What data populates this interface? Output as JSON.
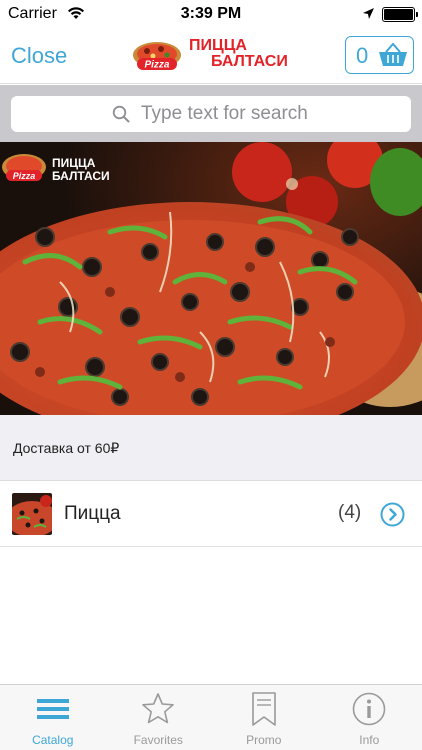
{
  "status_bar": {
    "carrier": "Carrier",
    "time": "3:39 PM"
  },
  "navbar": {
    "close_label": "Close",
    "logo_line1": "ПИЦЦА",
    "logo_line2": "БАЛТАСИ",
    "logo_badge_text": "Pizza",
    "cart_count": "0"
  },
  "search": {
    "placeholder": "Type text for search"
  },
  "banner": {
    "logo_line1": "ПИЦЦА",
    "logo_line2": "БАЛТАСИ",
    "logo_badge_text": "Pizza"
  },
  "delivery": {
    "text": "Доставка от 60₽"
  },
  "catalog": {
    "items": [
      {
        "label": "Пицца",
        "count": "(4)"
      }
    ]
  },
  "tabbar": {
    "tabs": [
      {
        "label": "Catalog",
        "icon": "hamburger-list-icon",
        "active": true
      },
      {
        "label": "Favorites",
        "icon": "star-icon",
        "active": false
      },
      {
        "label": "Promo",
        "icon": "bookmark-icon",
        "active": false
      },
      {
        "label": "Info",
        "icon": "info-icon",
        "active": false
      }
    ]
  },
  "colors": {
    "accent": "#3fa7d6",
    "brand_red": "#e2232a",
    "inactive": "#9a9a9a"
  }
}
